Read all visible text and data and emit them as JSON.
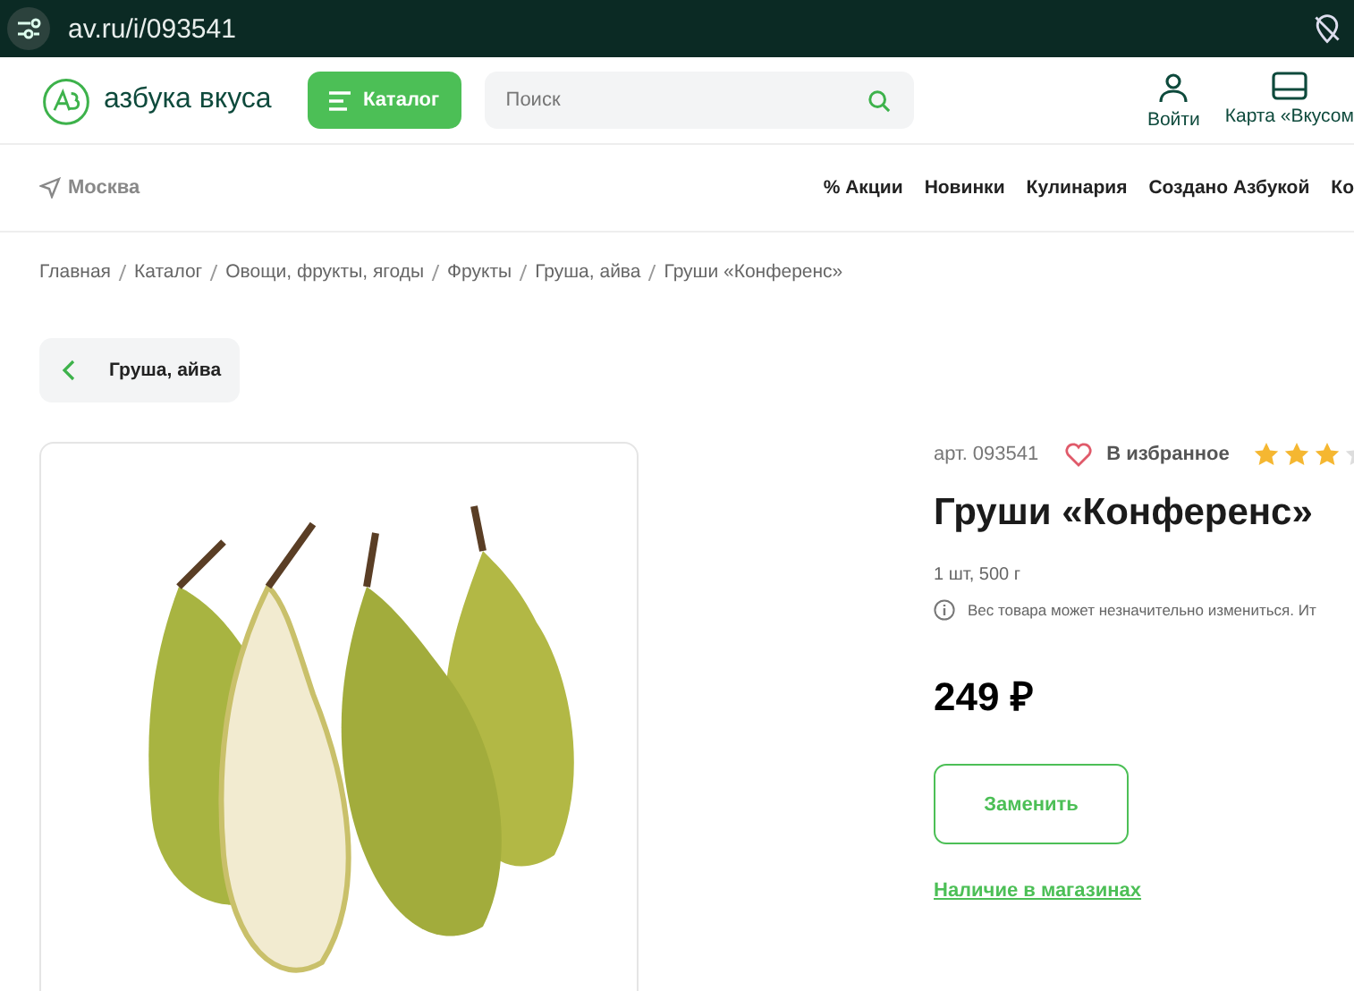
{
  "browser": {
    "url": "av.ru/i/093541"
  },
  "header": {
    "logo": "азбука вкуса",
    "catalog_button": "Каталог",
    "search": {
      "placeholder": "Поиск"
    },
    "actions": [
      {
        "label": "Войти",
        "kind": "user"
      },
      {
        "label": "Карта «Вкусом",
        "kind": "card"
      }
    ]
  },
  "nav": {
    "city": "Москва",
    "links": [
      "% Акции",
      "Новинки",
      "Кулинария",
      "Создано Азбукой",
      "Ко"
    ]
  },
  "breadcrumbs": [
    "Главная",
    "Каталог",
    "Овощи, фрукты, ягоды",
    "Фрукты",
    "Груша, айва",
    "Груши «Конференс»"
  ],
  "back_button": "Груша, айва",
  "product": {
    "article": "арт. 093541",
    "favorite": {
      "label": "В избранное",
      "selected": false
    },
    "stars": 3,
    "title": "Груши «Конференс»",
    "pack": "1 шт, 500 г",
    "weight_note": "Вес товара может незначительно измениться. Ит",
    "price": "249 ₽",
    "replace_button": "Заменить",
    "availability_link": "Наличие в магазинах"
  }
}
